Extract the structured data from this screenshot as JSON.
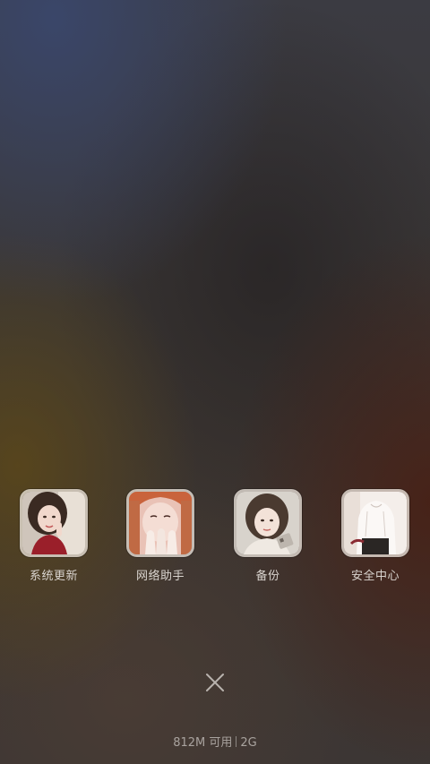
{
  "recent_apps": [
    {
      "label": "系统更新",
      "icon": "photo-girl-red-top-icon"
    },
    {
      "label": "网络助手",
      "icon": "photo-girl-hands-face-icon"
    },
    {
      "label": "备份",
      "icon": "photo-girl-phone-icon"
    },
    {
      "label": "安全中心",
      "icon": "photo-girl-white-shirt-icon"
    }
  ],
  "close_icon": "close-icon",
  "status": {
    "memory_available": "812M 可用",
    "memory_total": "2G"
  },
  "colors": {
    "label_text": "#d9d4cf",
    "status_text": "#a9a39f"
  }
}
